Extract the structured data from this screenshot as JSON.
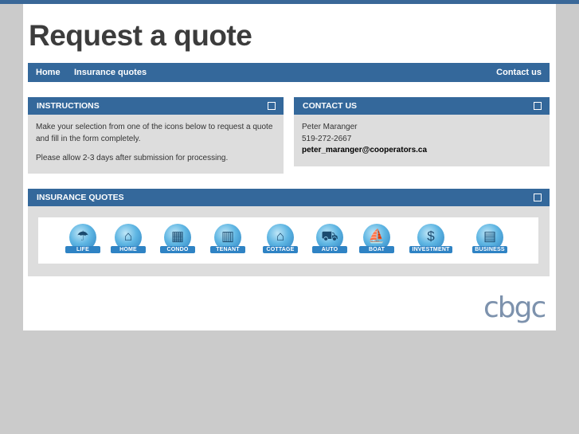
{
  "page": {
    "title": "Request a quote"
  },
  "nav": {
    "home": "Home",
    "insurance_quotes": "Insurance quotes",
    "contact_us": "Contact us"
  },
  "instructions": {
    "heading": "INSTRUCTIONS",
    "line1": "Make your selection from one of the icons below to request a quote",
    "line2": "and fill in the form completely.",
    "line3": "Please allow 2-3 days after submission for processing."
  },
  "contact": {
    "heading": "CONTACT US",
    "name": "Peter Maranger",
    "phone": "519-272-2667",
    "email": "peter_maranger@cooperators.ca"
  },
  "quotes": {
    "heading": "INSURANCE QUOTES",
    "items": [
      {
        "label": "LIFE",
        "icon": "life-umbrella-icon"
      },
      {
        "label": "HOME",
        "icon": "home-icon"
      },
      {
        "label": "CONDO",
        "icon": "condo-icon"
      },
      {
        "label": "TENANT",
        "icon": "tenant-icon"
      },
      {
        "label": "COTTAGE",
        "icon": "cottage-icon"
      },
      {
        "label": "AUTO",
        "icon": "auto-icon"
      },
      {
        "label": "BOAT",
        "icon": "boat-icon"
      },
      {
        "label": "INVESTMENT",
        "icon": "investment-icon"
      },
      {
        "label": "BUSINESS",
        "icon": "business-icon"
      }
    ]
  },
  "footer": {
    "logo_text": "cbgc"
  },
  "colors": {
    "brand_blue": "#34689b",
    "panel_grey": "#dddddd",
    "background": "#cbcbcb"
  }
}
